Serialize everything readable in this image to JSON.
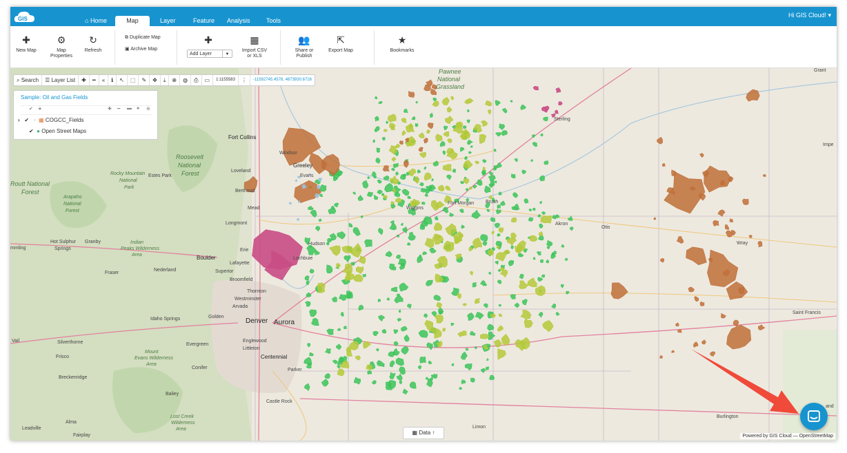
{
  "app": {
    "logo_text": "GIS",
    "user_menu": "Hi GIS Cloud! ▾"
  },
  "nav": {
    "tabs": [
      {
        "label": "Home",
        "icon": "home-icon"
      },
      {
        "label": "Map",
        "active": true
      },
      {
        "label": "Layer"
      },
      {
        "label": "Feature"
      },
      {
        "label": "Analysis"
      },
      {
        "label": "Tools"
      }
    ]
  },
  "ribbon": {
    "new_map": "New Map",
    "map_properties_1": "Map",
    "map_properties_2": "Properties",
    "refresh": "Refresh",
    "duplicate_map": "Duplicate Map",
    "archive_map": "Archive Map",
    "add_layer": "Add Layer",
    "import_csv_1": "Import CSV",
    "import_csv_2": "or XLS",
    "share_1": "Share or",
    "share_2": "Publish",
    "export_map": "Export Map",
    "bookmarks": "Bookmarks"
  },
  "toolbar": {
    "search": "Search",
    "layer_list": "Layer List",
    "scale": "1:1155583",
    "coords": "-11592745.4578, 4873930.6716"
  },
  "layer_panel": {
    "title": "Sample: Oil and Gas Fields",
    "layers": [
      {
        "name": "COGCC_Fields"
      },
      {
        "name": "Open Street Maps"
      }
    ]
  },
  "map_labels": {
    "pawnee_1": "Pawnee",
    "pawnee_2": "National",
    "pawnee_3": "Grassland",
    "grant": "Grant",
    "imperial": "Impe",
    "sterling": "Sterling",
    "fort_collins": "Fort Collins",
    "windsor": "Windsor",
    "greeley": "Greeley",
    "evans": "Evans",
    "loveland": "Loveland",
    "berthoud": "Berthoud",
    "mead": "Mead",
    "longmont": "Longmont",
    "erie": "Erie",
    "boulder": "Boulder",
    "lafayette": "Lafayette",
    "superior": "Superior",
    "broomfield": "Broomfield",
    "thornton": "Thornton",
    "westminster": "Westminster",
    "arvada": "Arvada",
    "golden": "Golden",
    "denver": "Denver",
    "aurora": "Aurora",
    "englewood": "Englewood",
    "littleton": "Littleton",
    "centennial": "Centennial",
    "parker": "Parker",
    "castle_rock": "Castle Rock",
    "hudson": "Hudson",
    "lochbuie": "Lochbuie",
    "wiggins": "Wiggins",
    "fort_morgan": "Fort Morgan",
    "brush": "Brush",
    "akron": "Akron",
    "otis": "Otis",
    "wray": "Wray",
    "saint_francis": "Saint Francis",
    "burlington": "Burlington",
    "limon": "Limon",
    "roosevelt_1": "Roosevelt",
    "roosevelt_2": "National",
    "roosevelt_3": "Forest",
    "rmnp_1": "Rocky Mountain",
    "rmnp_2": "National",
    "rmnp_3": "Park",
    "estes_park": "Estes Park",
    "routt_1": "Routt National",
    "routt_2": "Forest",
    "arapaho_1": "Arapaho",
    "arapaho_2": "National",
    "arapaho_3": "Forest",
    "hot_sulphur_1": "Hot Sulphur",
    "hot_sulphur_2": "Springs",
    "granby": "Granby",
    "kremmling": "mmling",
    "indian_peaks_1": "Indian",
    "indian_peaks_2": "Peaks Wilderness",
    "indian_peaks_3": "Area",
    "nederland": "Nederland",
    "fraser": "Fraser",
    "idaho_springs": "Idaho Springs",
    "vail": "Vail",
    "silverthorne": "Silverthorne",
    "frisco": "Frisco",
    "evergreen": "Evergreen",
    "conifer": "Conifer",
    "mount_evans_1": "Mount",
    "mount_evans_2": "Evans Wilderness",
    "mount_evans_3": "Area",
    "breckenridge": "Breckenridge",
    "bailey": "Bailey",
    "lost_creek_1": "Lost Creek",
    "lost_creek_2": "Wilderness",
    "lost_creek_3": "Area",
    "alma": "Alma",
    "leadville": "Leadville",
    "fairplay": "Fairplay",
    "kirk_land": "and"
  },
  "data_button": "Data",
  "attribution": "Powered by GIS Cloud — OpenStreetMap",
  "colors": {
    "brand_blue": "#1794cf",
    "field_orange": "#c0703a",
    "field_green": "#3cc45a",
    "field_lime": "#b5c93a",
    "field_magenta": "#c94d85",
    "arrow_red": "#f04a3a"
  }
}
